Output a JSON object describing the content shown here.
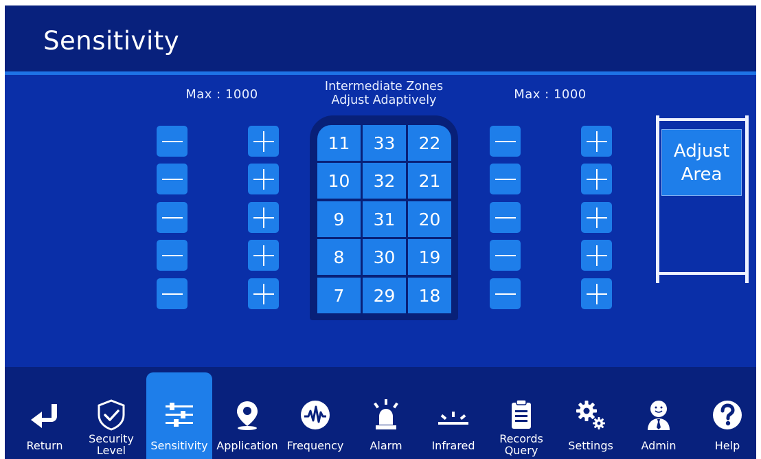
{
  "header": {
    "title": "Sensitivity"
  },
  "captions": {
    "max_left": "Max : 1000",
    "max_right": "Max : 1000",
    "intermediate_line1": "Intermediate Zones",
    "intermediate_line2": "Adjust Adaptively"
  },
  "zones": {
    "rows": [
      [
        "11",
        "33",
        "22"
      ],
      [
        "10",
        "32",
        "21"
      ],
      [
        "9",
        "31",
        "20"
      ],
      [
        "8",
        "30",
        "19"
      ],
      [
        "7",
        "29",
        "18"
      ]
    ]
  },
  "adjust_area": {
    "line1": "Adjust",
    "line2": "Area"
  },
  "nav": {
    "active": "Sensitivity",
    "items": [
      {
        "label": "Return",
        "label2": "",
        "icon": "return-icon"
      },
      {
        "label": "Security",
        "label2": "Level",
        "icon": "shield-check-icon"
      },
      {
        "label": "Sensitivity",
        "label2": "",
        "icon": "sliders-icon"
      },
      {
        "label": "Application",
        "label2": "",
        "icon": "location-pin-icon"
      },
      {
        "label": "Frequency",
        "label2": "",
        "icon": "waveform-icon"
      },
      {
        "label": "Alarm",
        "label2": "",
        "icon": "alarm-light-icon"
      },
      {
        "label": "Infrared",
        "label2": "",
        "icon": "infrared-icon"
      },
      {
        "label": "Records",
        "label2": "Query",
        "icon": "clipboard-icon"
      },
      {
        "label": "Settings",
        "label2": "",
        "icon": "gears-icon"
      },
      {
        "label": "Admin",
        "label2": "",
        "icon": "admin-user-icon"
      },
      {
        "label": "Help",
        "label2": "",
        "icon": "help-icon"
      }
    ]
  },
  "colors": {
    "background": "#0a2fa8",
    "header": "#08217d",
    "accent": "#1e7eea",
    "text": "#ffffff"
  }
}
